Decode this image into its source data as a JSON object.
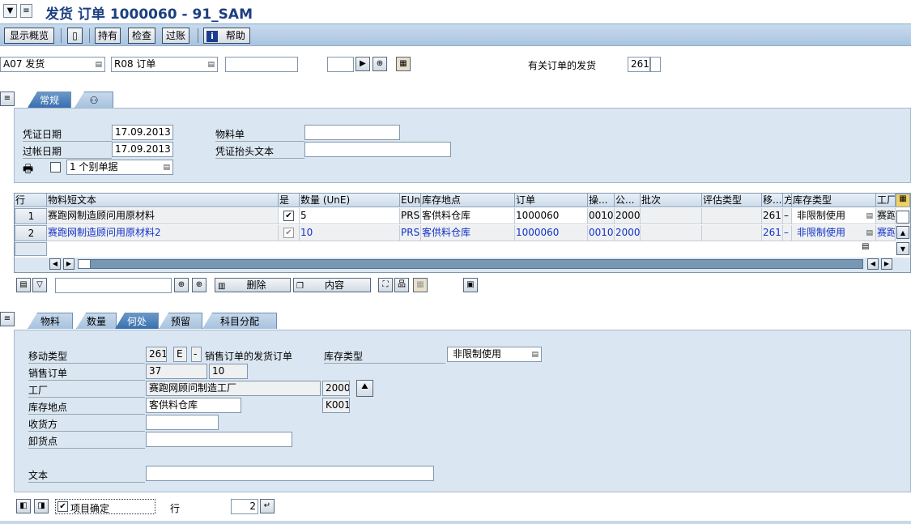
{
  "window": {
    "title": "发货 订单 1000060 - 91_SAM"
  },
  "toolbar": {
    "overview": "显示概览",
    "hold": "持有",
    "check": "检查",
    "post": "过账",
    "help": "帮助",
    "help_icon": "i"
  },
  "header": {
    "transaction": "A07 发货",
    "ref_doc": "R08 订单",
    "ref_label": "有关订单的发货",
    "movement": "261"
  },
  "top_tabs": [
    {
      "label": "常规"
    },
    {
      "label": ""
    }
  ],
  "general": {
    "doc_date_label": "凭证日期",
    "doc_date": "17.09.2013",
    "post_date_label": "过帐日期",
    "post_date": "17.09.2013",
    "mat_slip_label": "物料单",
    "header_text_label": "凭证抬头文本",
    "print_option": "1 个别单据"
  },
  "table": {
    "columns": [
      "行",
      "物料短文本",
      "是",
      "数量 (UnE)",
      "EUn",
      "库存地点",
      "订单",
      "操...",
      "公...",
      "批次",
      "评估类型",
      "移...",
      "方",
      "库存类型",
      "工厂"
    ],
    "rows": [
      {
        "line": "1",
        "text": "赛跑网制造顾问用原材料",
        "qty": "5",
        "unit": "PRS",
        "sloc": "客供料仓库",
        "order": "1000060",
        "op": "0010",
        "co": "2000",
        "mv": "261",
        "dir": "–",
        "stype": "非限制使用",
        "plant": "赛跑"
      },
      {
        "line": "2",
        "text": "赛跑网制造顾问用原材料2",
        "qty": "10",
        "unit": "PRS",
        "sloc": "客供料仓库",
        "order": "1000060",
        "op": "0010",
        "co": "2000",
        "mv": "261",
        "dir": "–",
        "stype": "非限制使用",
        "plant": "赛跑"
      }
    ]
  },
  "table_toolbar": {
    "delete": "删除",
    "contents": "内容"
  },
  "detail_tabs": [
    {
      "label": "物料"
    },
    {
      "label": "数量"
    },
    {
      "label": "何处"
    },
    {
      "label": "预留"
    },
    {
      "label": "科目分配"
    }
  ],
  "detail": {
    "mvt_label": "移动类型",
    "mvt": "261",
    "mvt_e": "E",
    "mvt_dash": "-",
    "mvt_text": "销售订单的发货订单",
    "stock_type_label": "库存类型",
    "stock_type": "非限制使用",
    "so_label": "销售订单",
    "so": "37",
    "so_item": "10",
    "plant_label": "工厂",
    "plant": "赛跑网顾问制造工厂",
    "plant_code": "2000",
    "sloc_label": "库存地点",
    "sloc": "客供料仓库",
    "sloc_code": "K001",
    "recipient_label": "收货方",
    "unload_label": "卸货点",
    "text_label": "文本"
  },
  "footer": {
    "item_ok": "项目确定",
    "line_label": "行",
    "line": "2"
  }
}
